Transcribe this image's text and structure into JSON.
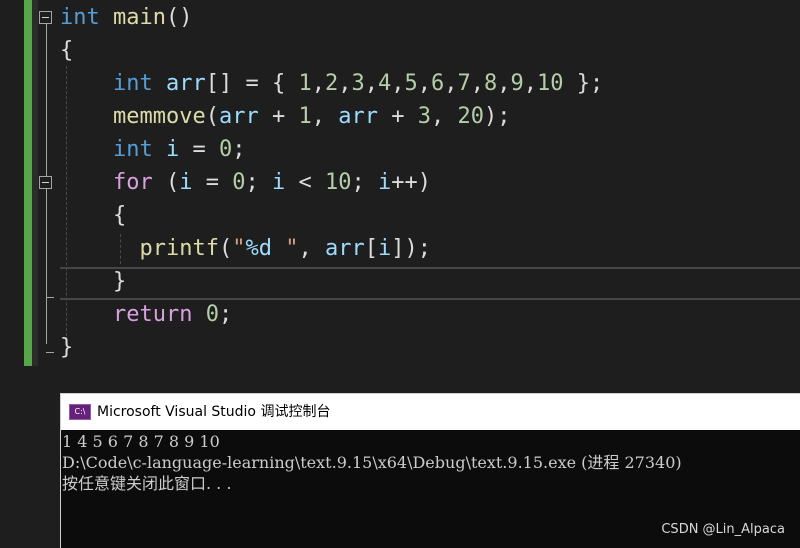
{
  "editor": {
    "lines": [
      {
        "tokens": [
          {
            "t": "int",
            "c": "kw"
          },
          {
            "t": " ",
            "c": "pn"
          },
          {
            "t": "main",
            "c": "fn"
          },
          {
            "t": "()",
            "c": "pn"
          }
        ]
      },
      {
        "tokens": [
          {
            "t": "{",
            "c": "pn"
          }
        ]
      },
      {
        "tokens": [
          {
            "t": "    ",
            "c": "pn"
          },
          {
            "t": "int",
            "c": "kw"
          },
          {
            "t": " ",
            "c": "pn"
          },
          {
            "t": "arr",
            "c": "var"
          },
          {
            "t": "[] = { ",
            "c": "pn"
          },
          {
            "t": "1",
            "c": "num"
          },
          {
            "t": ",",
            "c": "pn"
          },
          {
            "t": "2",
            "c": "num"
          },
          {
            "t": ",",
            "c": "pn"
          },
          {
            "t": "3",
            "c": "num"
          },
          {
            "t": ",",
            "c": "pn"
          },
          {
            "t": "4",
            "c": "num"
          },
          {
            "t": ",",
            "c": "pn"
          },
          {
            "t": "5",
            "c": "num"
          },
          {
            "t": ",",
            "c": "pn"
          },
          {
            "t": "6",
            "c": "num"
          },
          {
            "t": ",",
            "c": "pn"
          },
          {
            "t": "7",
            "c": "num"
          },
          {
            "t": ",",
            "c": "pn"
          },
          {
            "t": "8",
            "c": "num"
          },
          {
            "t": ",",
            "c": "pn"
          },
          {
            "t": "9",
            "c": "num"
          },
          {
            "t": ",",
            "c": "pn"
          },
          {
            "t": "10",
            "c": "num"
          },
          {
            "t": " };",
            "c": "pn"
          }
        ]
      },
      {
        "tokens": [
          {
            "t": "    ",
            "c": "pn"
          },
          {
            "t": "memmove",
            "c": "fn"
          },
          {
            "t": "(",
            "c": "pn"
          },
          {
            "t": "arr",
            "c": "var"
          },
          {
            "t": " + ",
            "c": "pn"
          },
          {
            "t": "1",
            "c": "num"
          },
          {
            "t": ", ",
            "c": "pn"
          },
          {
            "t": "arr",
            "c": "var"
          },
          {
            "t": " + ",
            "c": "pn"
          },
          {
            "t": "3",
            "c": "num"
          },
          {
            "t": ", ",
            "c": "pn"
          },
          {
            "t": "20",
            "c": "num"
          },
          {
            "t": ");",
            "c": "pn"
          }
        ]
      },
      {
        "tokens": [
          {
            "t": "    ",
            "c": "pn"
          },
          {
            "t": "int",
            "c": "kw"
          },
          {
            "t": " ",
            "c": "pn"
          },
          {
            "t": "i",
            "c": "var"
          },
          {
            "t": " = ",
            "c": "pn"
          },
          {
            "t": "0",
            "c": "num"
          },
          {
            "t": ";",
            "c": "pn"
          }
        ]
      },
      {
        "tokens": [
          {
            "t": "    ",
            "c": "pn"
          },
          {
            "t": "for",
            "c": "ctrl"
          },
          {
            "t": " (",
            "c": "pn"
          },
          {
            "t": "i",
            "c": "var"
          },
          {
            "t": " = ",
            "c": "pn"
          },
          {
            "t": "0",
            "c": "num"
          },
          {
            "t": "; ",
            "c": "pn"
          },
          {
            "t": "i",
            "c": "var"
          },
          {
            "t": " < ",
            "c": "pn"
          },
          {
            "t": "10",
            "c": "num"
          },
          {
            "t": "; ",
            "c": "pn"
          },
          {
            "t": "i",
            "c": "var"
          },
          {
            "t": "++)",
            "c": "pn"
          }
        ]
      },
      {
        "tokens": [
          {
            "t": "    {",
            "c": "pn"
          }
        ]
      },
      {
        "tokens": [
          {
            "t": "      ",
            "c": "pn"
          },
          {
            "t": "printf",
            "c": "fn"
          },
          {
            "t": "(",
            "c": "pn"
          },
          {
            "t": "\"",
            "c": "str"
          },
          {
            "t": "%d",
            "c": "fmt"
          },
          {
            "t": " \"",
            "c": "str"
          },
          {
            "t": ", ",
            "c": "pn"
          },
          {
            "t": "arr",
            "c": "var"
          },
          {
            "t": "[",
            "c": "pn"
          },
          {
            "t": "i",
            "c": "var"
          },
          {
            "t": "]);",
            "c": "pn"
          }
        ]
      },
      {
        "tokens": [
          {
            "t": "    }",
            "c": "pn"
          }
        ]
      },
      {
        "tokens": [
          {
            "t": "    ",
            "c": "pn"
          },
          {
            "t": "return",
            "c": "ctrl"
          },
          {
            "t": " ",
            "c": "pn"
          },
          {
            "t": "0",
            "c": "num"
          },
          {
            "t": ";",
            "c": "pn"
          }
        ]
      },
      {
        "tokens": [
          {
            "t": "}",
            "c": "pn"
          }
        ]
      }
    ]
  },
  "console": {
    "title": "Microsoft Visual Studio 调试控制台",
    "icon_label": "C:\\",
    "output": [
      "1 4 5 6 7 8 7 8 9 10",
      "D:\\Code\\c-language-learning\\text.9.15\\x64\\Debug\\text.9.15.exe (进程 27340)",
      "按任意键关闭此窗口. . ."
    ]
  },
  "watermark": "CSDN @Lin_Alpaca",
  "colors": {
    "editor_bg": "#1e1e1e",
    "change_bar": "#57a64a",
    "keyword": "#569cd6",
    "control": "#d8a0df",
    "function": "#dcdcaa",
    "variable": "#9cdcfe",
    "number": "#b5cea8",
    "string": "#d69d85",
    "console_bg": "#0c0c0c"
  },
  "icons": [
    "fold-collapse-icon",
    "visual-studio-console-icon"
  ]
}
